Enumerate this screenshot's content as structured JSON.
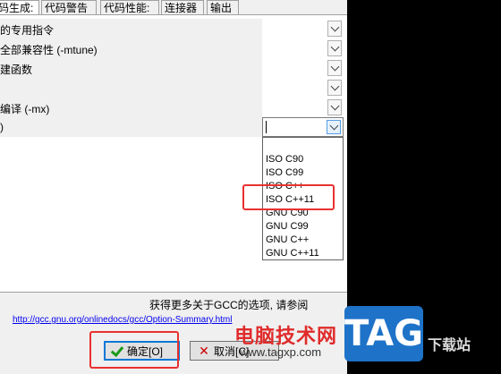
{
  "tabs": [
    "码生成:",
    "代码警告",
    "代码性能:",
    "连接器",
    "输出"
  ],
  "rows": [
    {
      "label": "的专用指令"
    },
    {
      "label": "全部兼容性 (-mtune)"
    },
    {
      "label": "建函数"
    },
    {
      "label": ""
    },
    {
      "label": "编译 (-mx)"
    },
    {
      "label": ")"
    }
  ],
  "dropdown": {
    "options": [
      "",
      "ISO C90",
      "ISO C99",
      "ISO C++",
      "ISO C++11",
      "GNU C90",
      "GNU C99",
      "GNU C++",
      "GNU C++11"
    ],
    "highlighted": "ISO C++11"
  },
  "info_text": "获得更多关于GCC的选项, 请参阅",
  "link_text": "http://gcc.gnu.org/onlinedocs/gcc/Option-Summary.html",
  "buttons": {
    "ok": "确定[O]",
    "cancel": "取消[C]"
  },
  "watermark": {
    "text": "电脑技术网",
    "url": "www.tagxp.com",
    "logo": "TAG",
    "tail": "下载站"
  },
  "colors": {
    "highlight": "#e8312f",
    "link": "#0000ee",
    "watermark_blue": "#1e73c8"
  }
}
